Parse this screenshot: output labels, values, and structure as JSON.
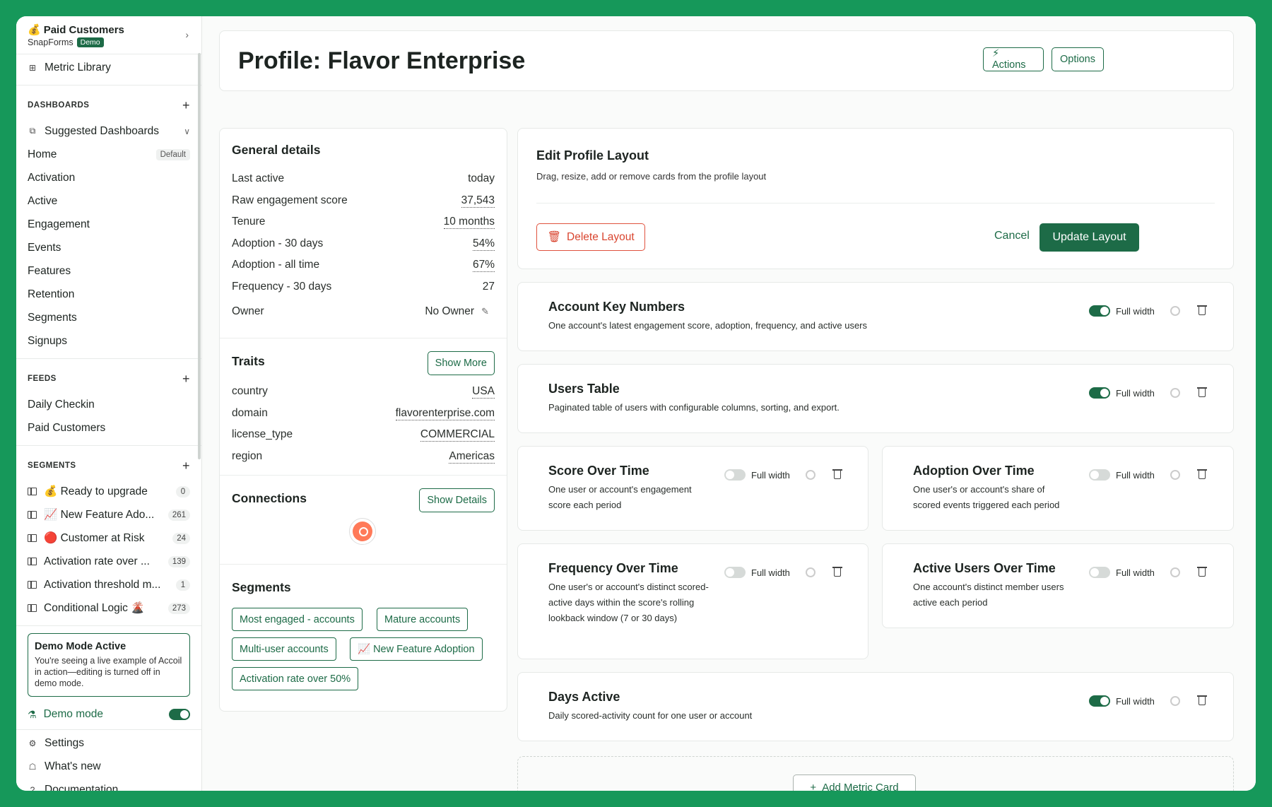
{
  "sidebar": {
    "org": {
      "name": "Paid Customers",
      "workspace": "SnapForms",
      "badge": "Demo",
      "emoji": "💰"
    },
    "metric_library": "Metric Library",
    "dashboards": {
      "header": "DASHBOARDS",
      "suggested": "Suggested Dashboards",
      "items": [
        {
          "label": "Home",
          "badge": "Default"
        },
        {
          "label": "Activation"
        },
        {
          "label": "Active"
        },
        {
          "label": "Engagement"
        },
        {
          "label": "Events"
        },
        {
          "label": "Features"
        },
        {
          "label": "Retention"
        },
        {
          "label": "Segments"
        },
        {
          "label": "Signups"
        }
      ]
    },
    "feeds": {
      "header": "FEEDS",
      "items": [
        "Daily Checkin",
        "Paid Customers"
      ]
    },
    "segments": {
      "header": "SEGMENTS",
      "items": [
        {
          "label": "💰 Ready to upgrade",
          "count": "0"
        },
        {
          "label": "📈 New Feature Ado...",
          "count": "261"
        },
        {
          "label": "🔴 Customer at Risk",
          "count": "24"
        },
        {
          "label": "Activation rate over ...",
          "count": "139"
        },
        {
          "label": "Activation threshold m...",
          "count": "1"
        },
        {
          "label": "Conditional Logic 🌋",
          "count": "273"
        }
      ]
    },
    "demo_box": {
      "title": "Demo Mode Active",
      "text": "You're seeing a live example of Accoil in action—editing is turned off in demo mode."
    },
    "demo_mode": "Demo mode",
    "footer": [
      "Settings",
      "What's new",
      "Documentation"
    ]
  },
  "header": {
    "title": "Profile: Flavor Enterprise",
    "actions": "⚡ Actions",
    "options": "Options"
  },
  "general": {
    "title": "General details",
    "rows": [
      {
        "k": "Last active",
        "v": "today"
      },
      {
        "k": "Raw engagement score",
        "v": "37,543"
      },
      {
        "k": "Tenure",
        "v": "10 months"
      },
      {
        "k": "Adoption - 30 days",
        "v": "54%"
      },
      {
        "k": "Adoption - all time",
        "v": "67%"
      },
      {
        "k": "Frequency - 30 days",
        "v": "27"
      }
    ],
    "owner_label": "Owner",
    "owner_value": "No Owner"
  },
  "traits": {
    "title": "Traits",
    "button": "Show More",
    "rows": [
      {
        "k": "country",
        "v": "USA"
      },
      {
        "k": "domain",
        "v": "flavorenterprise.com"
      },
      {
        "k": "license_type",
        "v": "COMMERCIAL"
      },
      {
        "k": "region",
        "v": "Americas"
      }
    ]
  },
  "connections": {
    "title": "Connections",
    "button": "Show Details"
  },
  "segments_card": {
    "title": "Segments",
    "chips": [
      "Most engaged - accounts",
      "Mature accounts",
      "Multi-user accounts",
      "📈 New Feature Adoption",
      "Activation rate over 50%"
    ]
  },
  "layout": {
    "title": "Edit Profile Layout",
    "subtitle": "Drag, resize, add or remove cards from the profile layout",
    "delete": "Delete Layout",
    "cancel": "Cancel",
    "update": "Update Layout"
  },
  "full_width_label": "Full width",
  "metric_cards": [
    {
      "title": "Account Key Numbers",
      "desc": "One account's latest engagement score, adoption, frequency, and active users",
      "full_width": true
    },
    {
      "title": "Users Table",
      "desc": "Paginated table of users with configurable columns, sorting, and export.",
      "full_width": true
    },
    {
      "title": "Score Over Time",
      "desc": "One user or account's engagement score each period",
      "full_width": false
    },
    {
      "title": "Adoption Over Time",
      "desc": "One user's or account's share of scored events triggered each period",
      "full_width": false
    },
    {
      "title": "Frequency Over Time",
      "desc": "One user's or account's distinct scored-active days within the score's rolling lookback window (7 or 30 days)",
      "full_width": false
    },
    {
      "title": "Active Users Over Time",
      "desc": "One account's distinct member users active each period",
      "full_width": false
    },
    {
      "title": "Days Active",
      "desc": "Daily scored-activity count for one user or account",
      "full_width": true
    }
  ],
  "add_metric_card": "Add Metric Card"
}
